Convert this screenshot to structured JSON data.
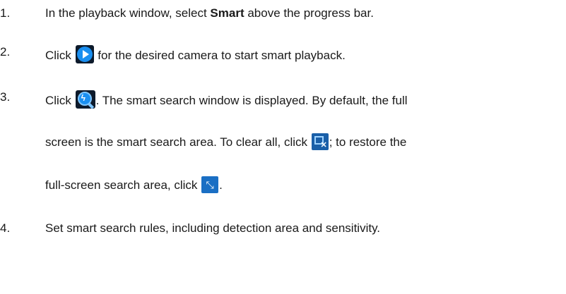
{
  "steps": [
    {
      "number": "1.",
      "pre": "In the playback window, select ",
      "bold": "Smart",
      "post": " above the progress bar."
    },
    {
      "number": "2.",
      "pre": "Click ",
      "icon": "play-icon",
      "post": " for the desired camera to start smart playback."
    },
    {
      "number": "3.",
      "line1_pre": "Click ",
      "line1_icon": "smart-search-icon",
      "line1_post": ". The smart search window is displayed. By default, the full",
      "line2_pre": "screen is the smart search area. To clear all, click ",
      "line2_icon": "clear-all-icon",
      "line2_post": "; to restore the",
      "line3_pre": "full-screen search area, click ",
      "line3_icon": "full-screen-icon",
      "line3_post": "."
    },
    {
      "number": "4.",
      "text": "Set smart search rules, including detection area and sensitivity."
    }
  ],
  "colors": {
    "text": "#1a1a1a",
    "icon_blue": "#1a8ff0",
    "icon_dark": "#0d1a2b"
  }
}
